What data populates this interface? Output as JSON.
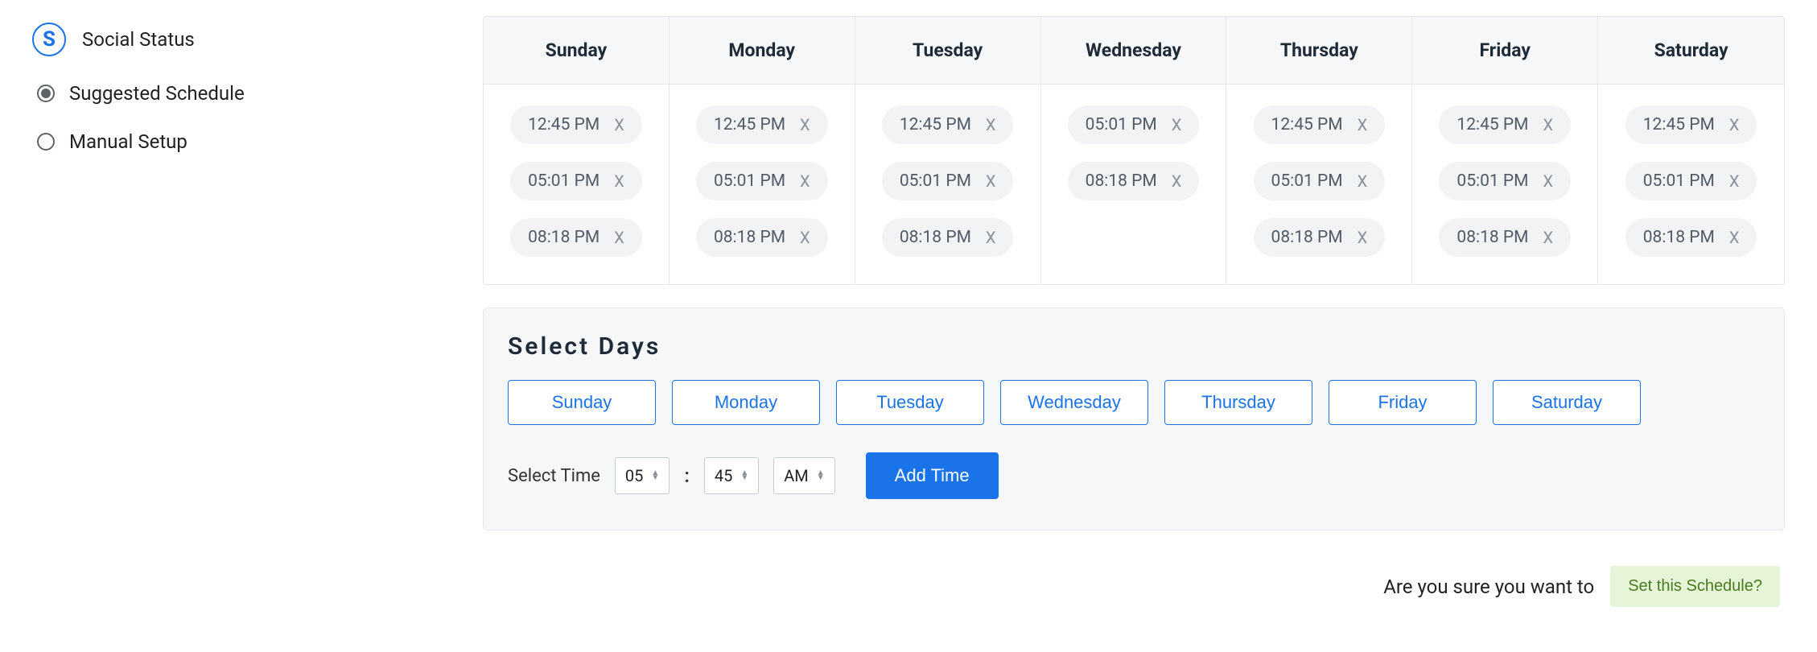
{
  "brand": {
    "logo_letter": "S",
    "name": "Social Status"
  },
  "options": {
    "suggested": {
      "label": "Suggested Schedule",
      "selected": true
    },
    "manual": {
      "label": "Manual Setup",
      "selected": false
    }
  },
  "schedule": {
    "days": [
      "Sunday",
      "Monday",
      "Tuesday",
      "Wednesday",
      "Thursday",
      "Friday",
      "Saturday"
    ],
    "columns": [
      {
        "times": [
          "12:45 PM",
          "05:01 PM",
          "08:18 PM"
        ]
      },
      {
        "times": [
          "12:45 PM",
          "05:01 PM",
          "08:18 PM"
        ]
      },
      {
        "times": [
          "12:45 PM",
          "05:01 PM",
          "08:18 PM"
        ]
      },
      {
        "times": [
          "05:01 PM",
          "08:18 PM"
        ]
      },
      {
        "times": [
          "12:45 PM",
          "05:01 PM",
          "08:18 PM"
        ]
      },
      {
        "times": [
          "12:45 PM",
          "05:01 PM",
          "08:18 PM"
        ]
      },
      {
        "times": [
          "12:45 PM",
          "05:01 PM",
          "08:18 PM"
        ]
      }
    ],
    "chip_remove_label": "X"
  },
  "select_days": {
    "title": "Select Days",
    "buttons": [
      "Sunday",
      "Monday",
      "Tuesday",
      "Wednesday",
      "Thursday",
      "Friday",
      "Saturday"
    ]
  },
  "select_time": {
    "label": "Select Time",
    "hour": "05",
    "minute": "45",
    "ampm": "AM",
    "add_button": "Add Time"
  },
  "confirm": {
    "prompt": "Are you sure you want to",
    "button": "Set this Schedule?"
  }
}
